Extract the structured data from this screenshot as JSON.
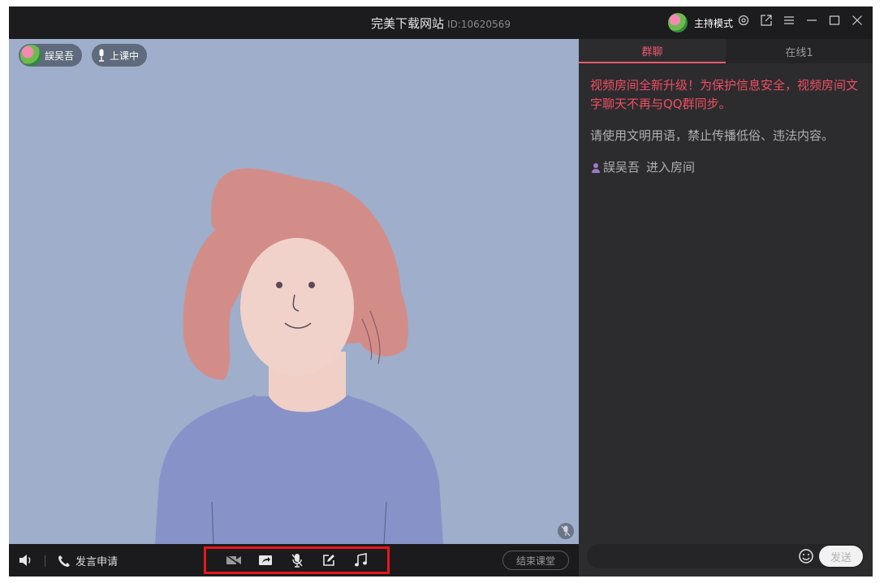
{
  "titlebar": {
    "title": "完美下载网站",
    "room_id": "ID:10620569",
    "host_mode_label": "主持模式",
    "icons": [
      "settings-icon",
      "popout-icon",
      "menu-icon",
      "minimize-icon",
      "maximize-icon",
      "close-icon"
    ]
  },
  "video": {
    "user_name": "誤吴吾",
    "status_label": "上课中"
  },
  "controls": {
    "apply_label": "发言申请",
    "tools": [
      "camera-off-icon",
      "screen-share-icon",
      "mic-off-icon",
      "whiteboard-icon",
      "music-icon"
    ],
    "end_label": "结束课堂"
  },
  "chat": {
    "tabs": [
      {
        "label": "群聊",
        "active": true
      },
      {
        "label": "在线1",
        "active": false
      }
    ],
    "notice": "视频房间全新升级！为保护信息安全，视频房间文字聊天不再与QQ群同步。",
    "rule": "请使用文明用语，禁止传播低俗、违法内容。",
    "enter_user": "誤吴吾",
    "enter_text": "进入房间",
    "send_label": "发送"
  },
  "colors": {
    "accent": "#f05a6e",
    "video_bg": "#9eaecb",
    "highlight_box": "#e8161c"
  }
}
